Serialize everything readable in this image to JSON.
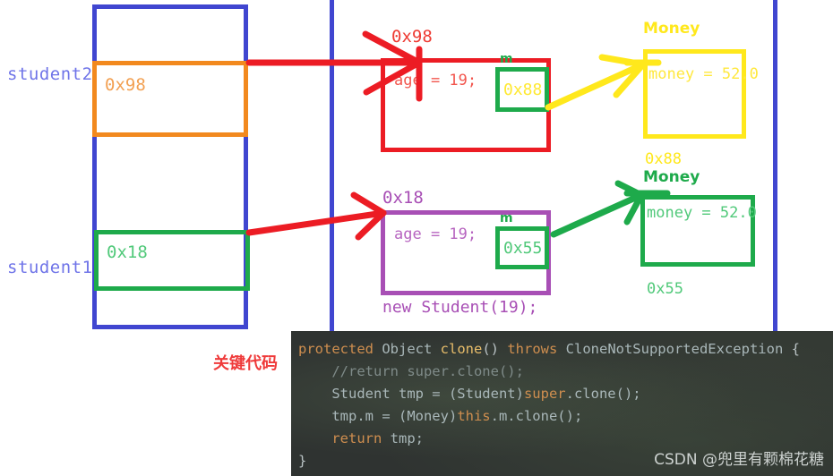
{
  "diagram": {
    "stack": {
      "label_student2": "student2",
      "label_student1": "student1",
      "student2_value": "0x98",
      "student1_value": "0x18"
    },
    "heap_student_a": {
      "address_label": "0x98",
      "field_age": "age = 19;",
      "member_label": "m",
      "member_value": "0x88"
    },
    "heap_student_b": {
      "address_label": "0x18",
      "field_age": "age = 19;",
      "member_label": "m",
      "member_value": "0x55",
      "caption": "new Student(19);"
    },
    "money_a": {
      "type_label": "Money",
      "field_money": "money = 52.0",
      "address_label": "0x88"
    },
    "money_b": {
      "type_label": "Money",
      "field_money": "money = 52.0",
      "address_label": "0x55"
    },
    "key_code_label": "关键代码"
  },
  "code": {
    "lines": [
      [
        {
          "t": "protected ",
          "c": "kw"
        },
        {
          "t": "Object ",
          "c": "ty"
        },
        {
          "t": "clone",
          "c": "fn"
        },
        {
          "t": "() ",
          "c": "pl"
        },
        {
          "t": "throws ",
          "c": "kw"
        },
        {
          "t": "CloneNotSupportedException ",
          "c": "ty"
        },
        {
          "t": "{",
          "c": "pl"
        }
      ],
      [
        {
          "t": "    //return super.clone();",
          "c": "cm"
        }
      ],
      [
        {
          "t": "    Student tmp = (Student)",
          "c": "ty"
        },
        {
          "t": "super",
          "c": "kw"
        },
        {
          "t": ".clone();",
          "c": "ty"
        }
      ],
      [
        {
          "t": "    tmp.m = (Money)",
          "c": "ty"
        },
        {
          "t": "this",
          "c": "kw"
        },
        {
          "t": ".m.clone();",
          "c": "ty"
        }
      ],
      [
        {
          "t": "    return ",
          "c": "kw"
        },
        {
          "t": "tmp;",
          "c": "ty"
        }
      ],
      [
        {
          "t": "}",
          "c": "pl"
        }
      ]
    ],
    "watermark": "CSDN @兜里有颗棉花糖"
  },
  "colors": {
    "blue": "#4046d0",
    "orange": "#f2891e",
    "green": "#1eaa4b",
    "red": "#ec1c24",
    "purple": "#a84fb5",
    "yellow": "#ffe81c"
  }
}
